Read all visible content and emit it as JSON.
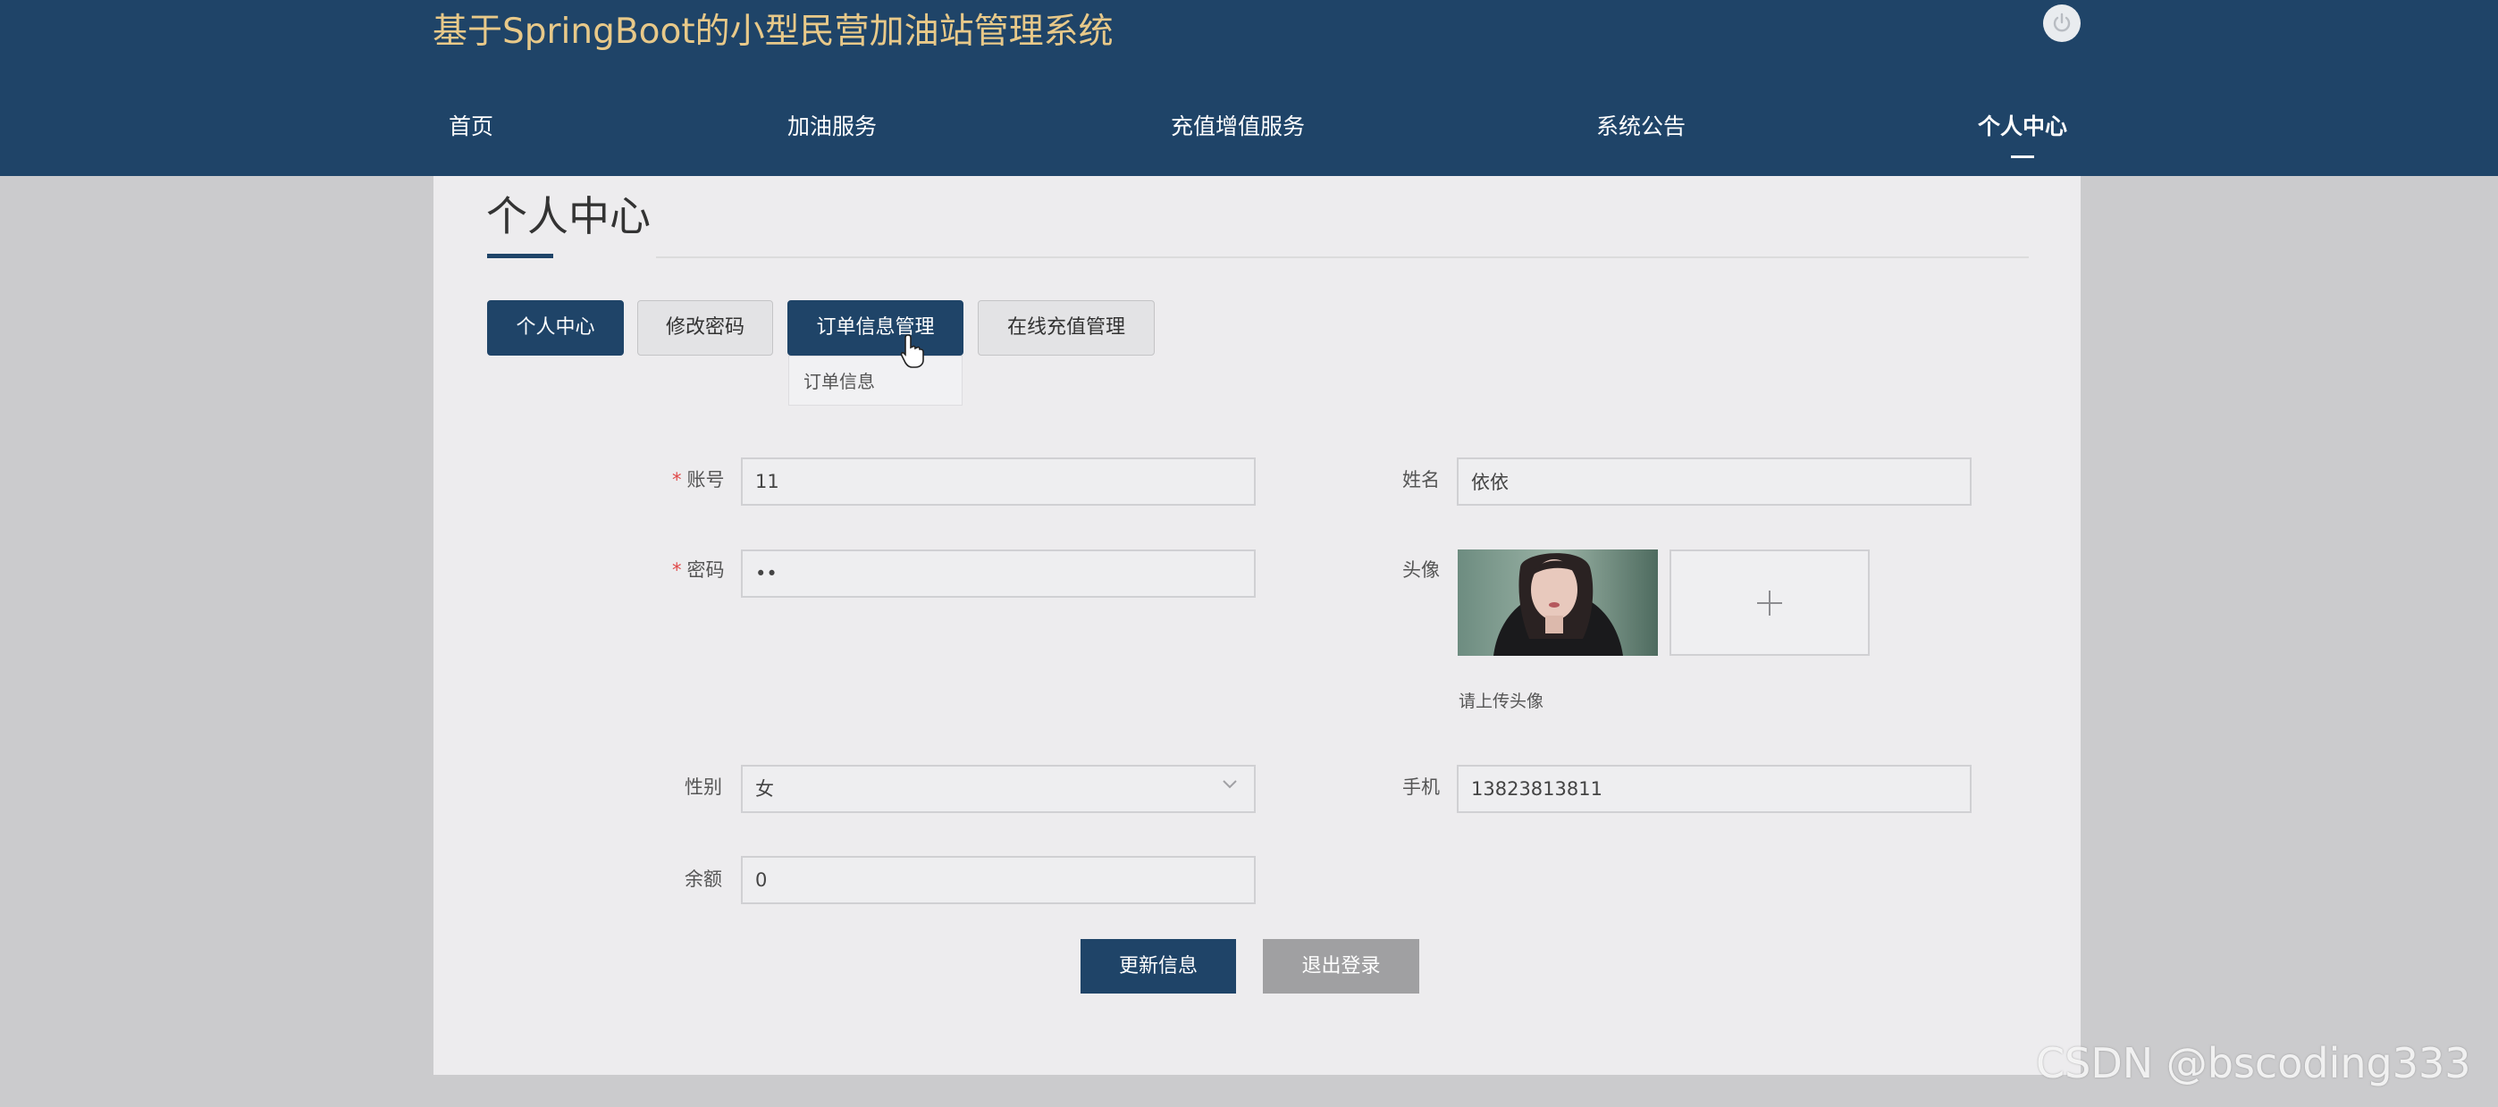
{
  "header": {
    "site_title": "基于SpringBoot的小型民营加油站管理系统",
    "nav": [
      {
        "label": "首页"
      },
      {
        "label": "加油服务"
      },
      {
        "label": "充值增值服务"
      },
      {
        "label": "系统公告"
      },
      {
        "label": "个人中心",
        "active": true
      }
    ]
  },
  "page": {
    "title": "个人中心"
  },
  "tabs": [
    {
      "label": "个人中心",
      "active": true
    },
    {
      "label": "修改密码"
    },
    {
      "label": "订单信息管理",
      "active": true
    },
    {
      "label": "在线充值管理"
    }
  ],
  "dropdown": {
    "items": [
      "订单信息"
    ]
  },
  "form": {
    "account": {
      "label": "账号",
      "required": true,
      "value": "11"
    },
    "password": {
      "label": "密码",
      "required": true,
      "value": "••"
    },
    "name": {
      "label": "姓名",
      "value": "依依"
    },
    "avatar": {
      "label": "头像",
      "hint": "请上传头像",
      "upload_icon": "plus-icon"
    },
    "gender": {
      "label": "性别",
      "value": "女"
    },
    "phone": {
      "label": "手机",
      "value": "13823813811"
    },
    "balance": {
      "label": "余额",
      "value": "0"
    }
  },
  "buttons": {
    "update": "更新信息",
    "logout": "退出登录"
  },
  "watermark": "CSDN @bscoding333",
  "colors": {
    "primary": "#1f4468",
    "title_gold": "#e8c989",
    "required": "#e04848",
    "logout_gray": "#a0a0a2"
  }
}
